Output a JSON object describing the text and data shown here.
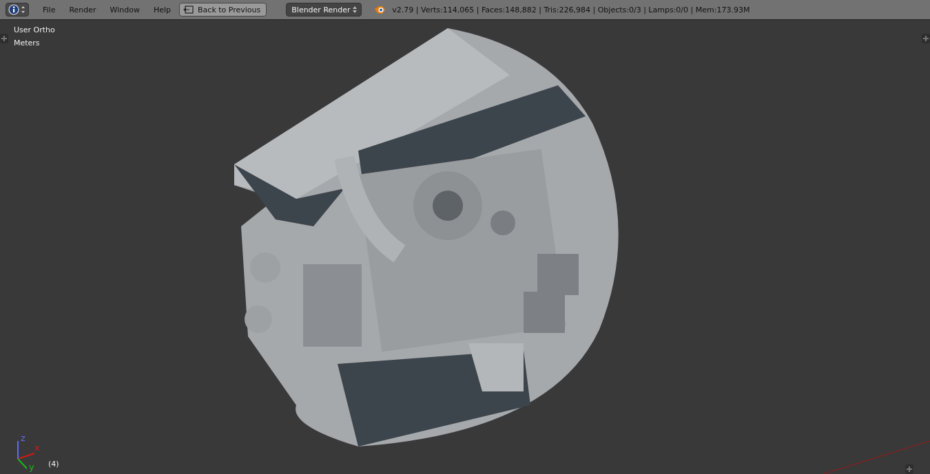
{
  "header": {
    "menu_items": [
      "File",
      "Render",
      "Window",
      "Help"
    ],
    "back_button": "Back to Previous",
    "render_engine": "Blender Render",
    "stats": "v2.79 | Verts:114,065 | Faces:148,882 | Tris:226,984 | Objects:0/3 | Lamps:0/0 | Mem:173.93M"
  },
  "viewport": {
    "view_name": "User Ortho",
    "units": "Meters",
    "frame": "(4)",
    "axes": [
      {
        "label": "z",
        "color": "#5a6cff"
      },
      {
        "label": "x",
        "color": "#d01a1a"
      },
      {
        "label": "y",
        "color": "#1ab81a"
      }
    ]
  }
}
